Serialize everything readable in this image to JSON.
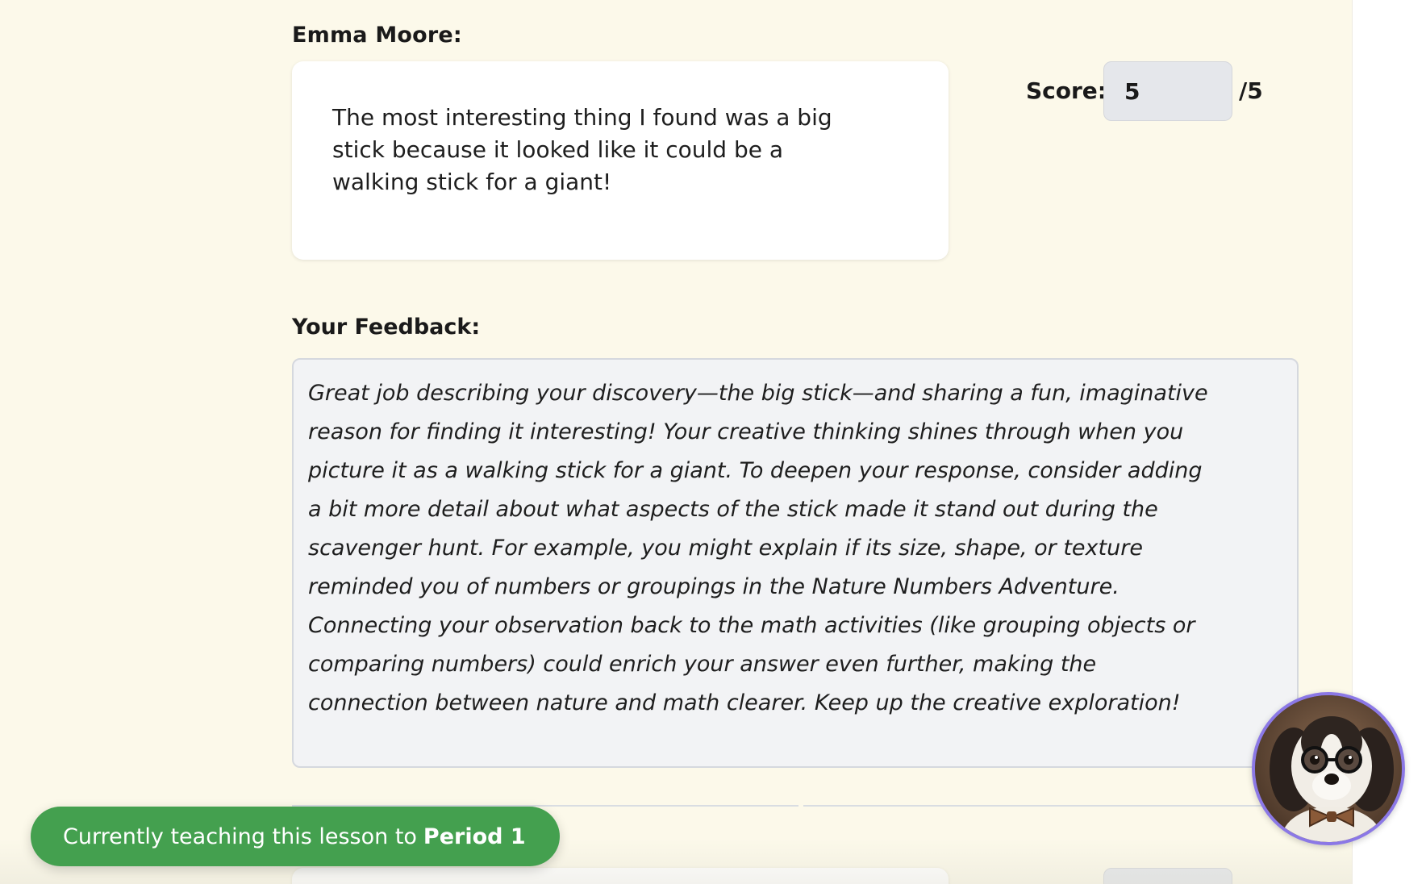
{
  "student": {
    "name": "Emma Moore:",
    "answer": "The most interesting thing I found was a big stick because it looked like it could be a walking stick for a giant!"
  },
  "score": {
    "label": "Score:",
    "value": "5",
    "max": "/5"
  },
  "feedback": {
    "heading": "Your Feedback:",
    "text": "Great job describing your discovery—the big stick—and sharing a fun, imaginative reason for finding it interesting! Your creative thinking shines through when you picture it as a walking stick for a giant. To deepen your response, consider adding a bit more detail about what aspects of the stick made it stand out during the scavenger hunt. For example, you might explain if its size, shape, or texture reminded you of numbers or groupings in the Nature Numbers Adventure. Connecting your observation back to the math activities (like grouping objects or comparing numbers) could enrich your answer even further, making the connection between nature and math clearer. Keep up the creative exploration!"
  },
  "banner": {
    "prefix": "Currently teaching this lesson to",
    "period": "Period 1"
  },
  "assistant": {
    "icon": "dog-assistant-avatar-icon"
  },
  "colors": {
    "page_bg": "#fcf9ea",
    "banner_green": "#44a04f",
    "avatar_ring": "#8b78e6",
    "score_input_bg": "#e5e7eb",
    "feedback_bg": "#f2f3f5"
  }
}
